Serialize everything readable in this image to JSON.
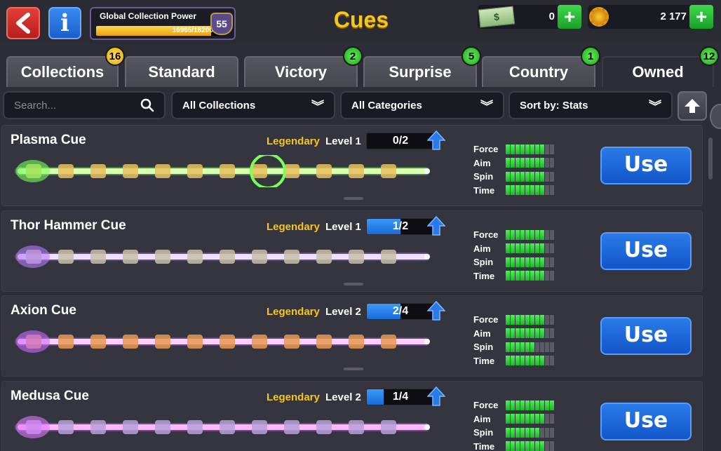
{
  "header": {
    "title": "Cues",
    "gcp_title": "Global Collection Power",
    "gcp_value": "16965/18200",
    "gcp_progress": 0.932,
    "gcp_level": "55",
    "cash": "0",
    "coins": "2 177"
  },
  "tabs": [
    {
      "label": "Collections",
      "badge": "16",
      "badge_color": "yellow"
    },
    {
      "label": "Standard",
      "badge": "",
      "badge_color": ""
    },
    {
      "label": "Victory",
      "badge": "2",
      "badge_color": "green"
    },
    {
      "label": "Surprise",
      "badge": "5",
      "badge_color": "green"
    },
    {
      "label": "Country",
      "badge": "1",
      "badge_color": "green"
    },
    {
      "label": "Owned",
      "badge": "12",
      "badge_color": "green",
      "active": true
    }
  ],
  "filters": {
    "search_placeholder": "Search...",
    "collections": "All Collections",
    "categories": "All Categories",
    "sort": "Sort by: Stats"
  },
  "stat_labels": [
    "Force",
    "Aim",
    "Spin",
    "Time"
  ],
  "cues": [
    {
      "name": "Plasma Cue",
      "rarity": "Legendary",
      "level": "Level 1",
      "progress_text": "0/2",
      "progress": 0.0,
      "stats": [
        8,
        8,
        8,
        8
      ],
      "use_label": "Use",
      "theme": "green"
    },
    {
      "name": "Thor Hammer Cue",
      "rarity": "Legendary",
      "level": "Level 1",
      "progress_text": "1/2",
      "progress": 0.5,
      "stats": [
        8,
        8,
        8,
        8
      ],
      "use_label": "Use",
      "theme": "purple"
    },
    {
      "name": "Axion Cue",
      "rarity": "Legendary",
      "level": "Level 2",
      "progress_text": "2/4",
      "progress": 0.5,
      "stats": [
        8,
        8,
        6,
        8
      ],
      "use_label": "Use",
      "theme": "violet"
    },
    {
      "name": "Medusa Cue",
      "rarity": "Legendary",
      "level": "Level 2",
      "progress_text": "1/4",
      "progress": 0.25,
      "stats": [
        10,
        8,
        7,
        8
      ],
      "use_label": "Use",
      "theme": "pink"
    }
  ],
  "colors": {
    "accent_yellow": "#f6c61c",
    "use_button": "#1a66d8",
    "stat_on": "#2ad83a",
    "background": "#2c2d36"
  }
}
